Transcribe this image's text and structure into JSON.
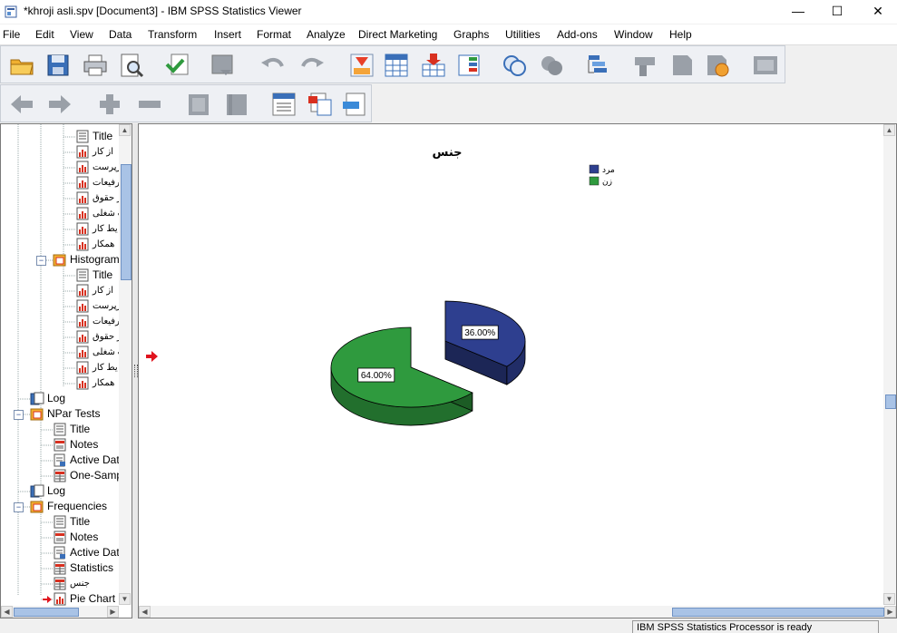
{
  "window": {
    "title": "*khroji asli.spv [Document3] - IBM SPSS Statistics Viewer",
    "minimize": "—",
    "maximize": "☐",
    "close": "✕"
  },
  "menu": [
    "File",
    "Edit",
    "View",
    "Data",
    "Transform",
    "Insert",
    "Format",
    "Analyze",
    "Direct Marketing",
    "Graphs",
    "Utilities",
    "Add-ons",
    "Window",
    "Help"
  ],
  "toolbar1_icons": [
    "open-icon",
    "save-icon",
    "print-icon",
    "print-preview-icon",
    "export-icon",
    "recall-dialog-icon",
    "undo-icon",
    "redo-icon",
    "goto-case-icon",
    "goto-variable-icon",
    "insert-cases-icon",
    "variables-icon",
    "select-cases-icon",
    "weight-cases-icon",
    "split-file-icon",
    "value-labels-icon",
    "use-sets-icon",
    "show-all-icon",
    "run-script-icon",
    "designate-window-icon"
  ],
  "toolbar2_icons": [
    "promote-icon",
    "demote-icon",
    "expand-icon",
    "collapse-icon",
    "show-icon",
    "hide-icon",
    "insert-heading-icon",
    "insert-title-icon",
    "insert-text-icon"
  ],
  "nav_tree": [
    {
      "label": "Title",
      "type": "title"
    },
    {
      "label": "از کار",
      "type": "chart"
    },
    {
      "label": "رپرست",
      "type": "chart"
    },
    {
      "label": "رفیعات",
      "type": "chart"
    },
    {
      "label": "ز حقوق",
      "type": "chart"
    },
    {
      "label": "ت شغلی",
      "type": "chart"
    },
    {
      "label": "یط کار",
      "type": "chart"
    },
    {
      "label": "همکار",
      "type": "chart"
    },
    {
      "label": "Histogram",
      "type": "folder"
    },
    {
      "label": "Title",
      "type": "title"
    },
    {
      "label": "از کار",
      "type": "chart"
    },
    {
      "label": "رپرست",
      "type": "chart"
    },
    {
      "label": "رفیعات",
      "type": "chart"
    },
    {
      "label": "ز حقوق",
      "type": "chart"
    },
    {
      "label": "ت شغلی",
      "type": "chart"
    },
    {
      "label": "یط کار",
      "type": "chart"
    },
    {
      "label": "همکار",
      "type": "chart"
    },
    {
      "label": "Log",
      "type": "log"
    },
    {
      "label": "NPar Tests",
      "type": "folder"
    },
    {
      "label": "Title",
      "type": "title"
    },
    {
      "label": "Notes",
      "type": "notes"
    },
    {
      "label": "Active Data",
      "type": "doc"
    },
    {
      "label": "One-Samp",
      "type": "table"
    },
    {
      "label": "Log",
      "type": "log"
    },
    {
      "label": "Frequencies",
      "type": "folder"
    },
    {
      "label": "Title",
      "type": "title"
    },
    {
      "label": "Notes",
      "type": "notes"
    },
    {
      "label": "Active Data",
      "type": "doc"
    },
    {
      "label": "Statistics",
      "type": "table"
    },
    {
      "label": "جنس",
      "type": "table"
    },
    {
      "label": "Pie Chart",
      "type": "chart"
    }
  ],
  "status": "IBM SPSS Statistics Processor is ready",
  "chart_data": {
    "type": "pie",
    "title": "جنس",
    "categories": [
      "مرد",
      "زن"
    ],
    "values": [
      36.0,
      64.0
    ],
    "data_labels": [
      "36.00%",
      "64.00%"
    ],
    "colors": [
      "#2e3f8f",
      "#2f9a3e"
    ],
    "exploded": "مرد",
    "style": "3d",
    "legend_position": "top-right"
  }
}
